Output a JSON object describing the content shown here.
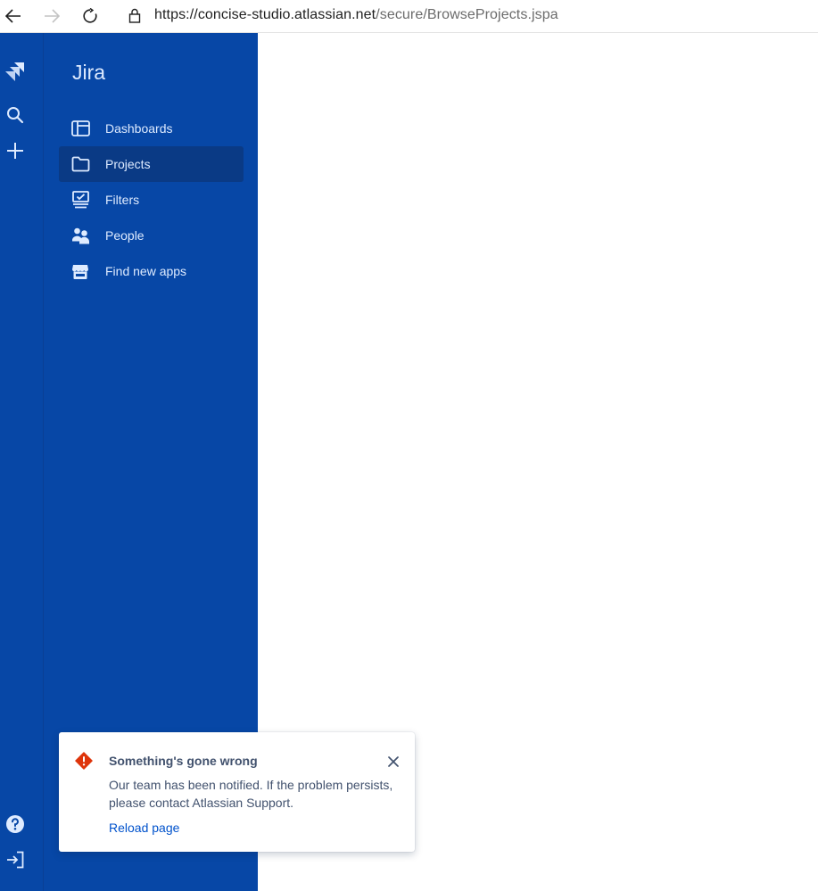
{
  "browser": {
    "url_host": "https://concise-studio.atlassian.net",
    "url_path": "/secure/BrowseProjects.jspa",
    "back_icon": "back-arrow-icon",
    "forward_icon": "forward-arrow-icon",
    "refresh_icon": "refresh-icon",
    "lock_icon": "lock-icon"
  },
  "global_nav": {
    "logo_icon": "jira-logo-icon",
    "search_icon": "search-icon",
    "create_icon": "plus-icon",
    "help_icon": "help-icon",
    "signout_icon": "sign-out-icon"
  },
  "sidebar": {
    "title": "Jira",
    "items": [
      {
        "label": "Dashboards",
        "icon": "dashboard-icon",
        "active": false
      },
      {
        "label": "Projects",
        "icon": "folder-icon",
        "active": true
      },
      {
        "label": "Filters",
        "icon": "filter-icon",
        "active": false
      },
      {
        "label": "People",
        "icon": "people-icon",
        "active": false
      },
      {
        "label": "Find new apps",
        "icon": "marketplace-icon",
        "active": false
      }
    ]
  },
  "flag": {
    "title": "Something's gone wrong",
    "body": "Our team has been notified. If the problem persists, please contact Atlassian Support.",
    "action": "Reload page",
    "icon": "error-icon",
    "close_icon": "close-icon"
  },
  "colors": {
    "nav_bg": "#0747a6",
    "nav_active": "#0a3a85",
    "nav_text": "#deebff",
    "error": "#de350b",
    "link": "#0052cc",
    "flag_text": "#42526e"
  }
}
